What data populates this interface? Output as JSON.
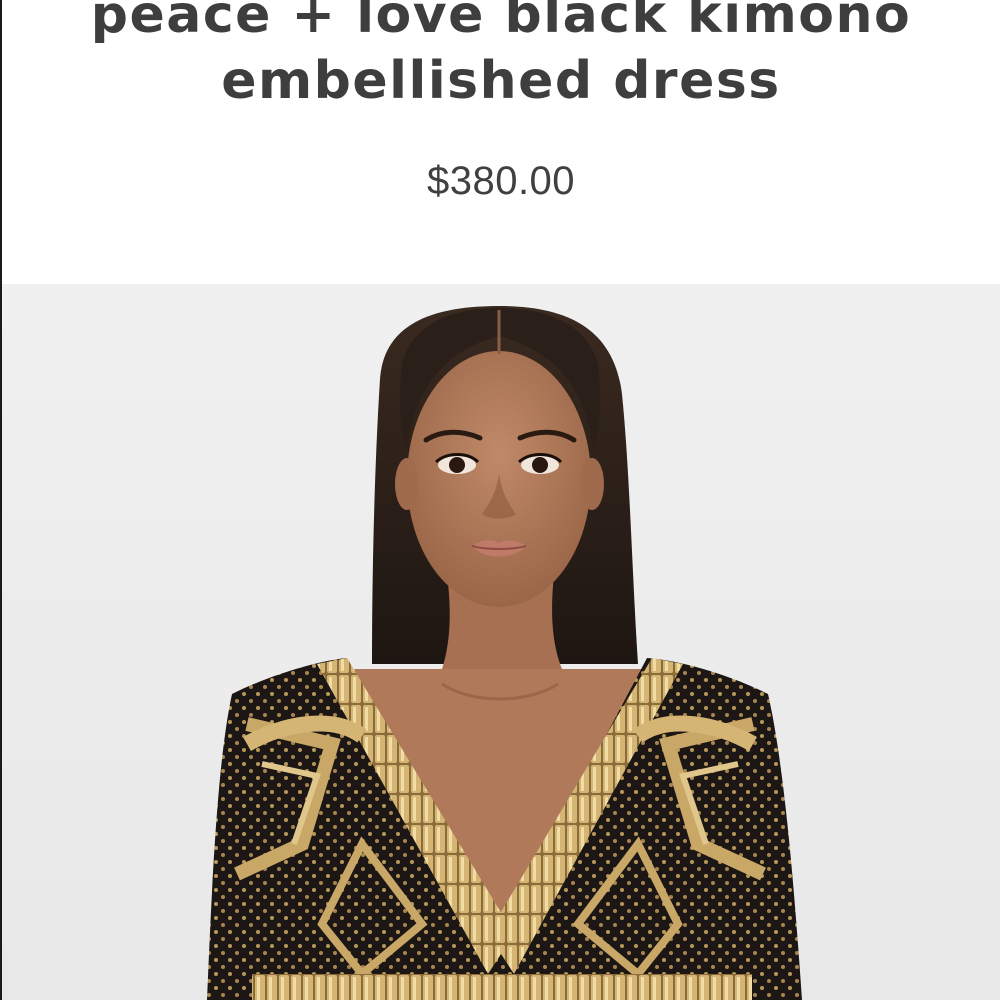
{
  "product": {
    "title_line1": "peace + love black kimono",
    "title_line2": "embellished dress",
    "price": "$380.00"
  },
  "image": {
    "subject": "product-photo",
    "colors": {
      "background": "#ededed",
      "skin": "#b07a5a",
      "hair": "#2b1f19",
      "dress": "#1c1714",
      "embellishment": "#c9a867"
    }
  }
}
